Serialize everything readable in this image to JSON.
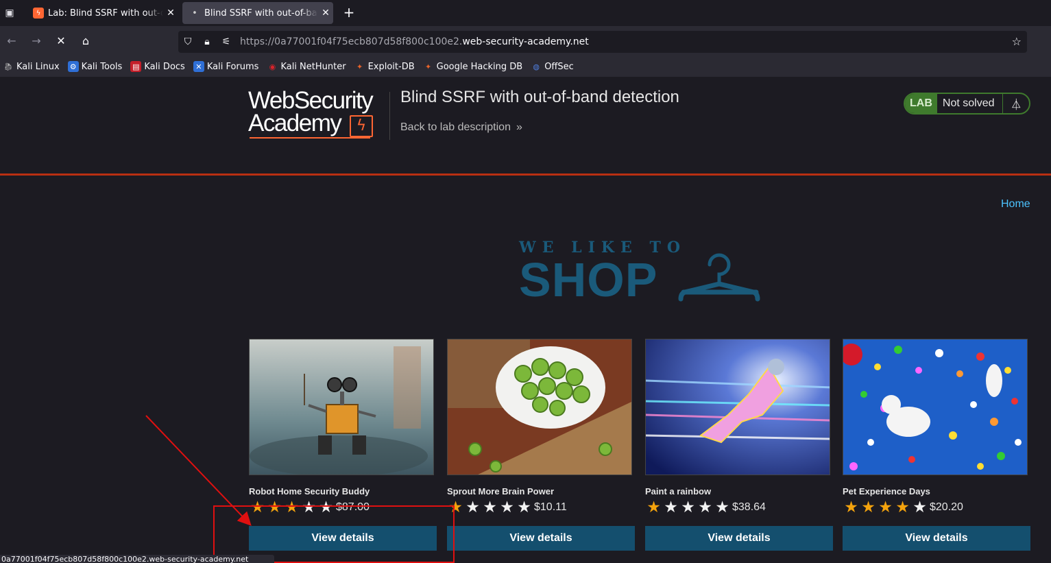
{
  "browser": {
    "tabs": [
      {
        "label": "Lab: Blind SSRF with out-of-band detection",
        "favicon": "burp-lightning-icon",
        "active": false
      },
      {
        "label": "Blind SSRF with out-of-band detection",
        "favicon": "loading-dot",
        "active": true
      }
    ],
    "url_prefix": "https://0a77001f04f75ecb807d58f800c100e2.",
    "url_domain": "web-security-academy.net",
    "bookmarks": [
      {
        "label": "Kali Linux",
        "icon": "kali-dragon-icon"
      },
      {
        "label": "Kali Tools",
        "icon": "kali-tools-icon"
      },
      {
        "label": "Kali Docs",
        "icon": "kali-docs-icon"
      },
      {
        "label": "Kali Forums",
        "icon": "kali-forums-icon"
      },
      {
        "label": "Kali NetHunter",
        "icon": "nethunter-icon"
      },
      {
        "label": "Exploit-DB",
        "icon": "exploit-db-icon"
      },
      {
        "label": "Google Hacking DB",
        "icon": "ghdb-icon"
      },
      {
        "label": "OffSec",
        "icon": "offsec-icon"
      }
    ],
    "status_url": "0a77001f04f75ecb807d58f800c100e2.web-security-academy.net"
  },
  "lab_header": {
    "logo_line1": "WebSecurity",
    "logo_line2": "Academy",
    "title": "Blind SSRF with out-of-band detection",
    "back_link": "Back to lab description",
    "badge": "LAB",
    "status": "Not solved"
  },
  "nav": {
    "home": "Home"
  },
  "banner": {
    "top": "WE LIKE TO",
    "bottom": "SHOP"
  },
  "products": [
    {
      "name": "Robot Home Security Buddy",
      "rating": 3,
      "price": "$87.00",
      "button": "View details"
    },
    {
      "name": "Sprout More Brain Power",
      "rating": 1,
      "price": "$10.11",
      "button": "View details"
    },
    {
      "name": "Paint a rainbow",
      "rating": 1,
      "price": "$38.64",
      "button": "View details"
    },
    {
      "name": "Pet Experience Days",
      "rating": 4,
      "price": "$20.20",
      "button": "View details"
    }
  ],
  "colors": {
    "accent": "#ff6633",
    "header_rule": "#b82f12",
    "button": "#144f6e",
    "lab_green": "#3f7a2d",
    "link": "#4cc3ff",
    "star": "#f4a30d",
    "annotation": "#e01010"
  }
}
